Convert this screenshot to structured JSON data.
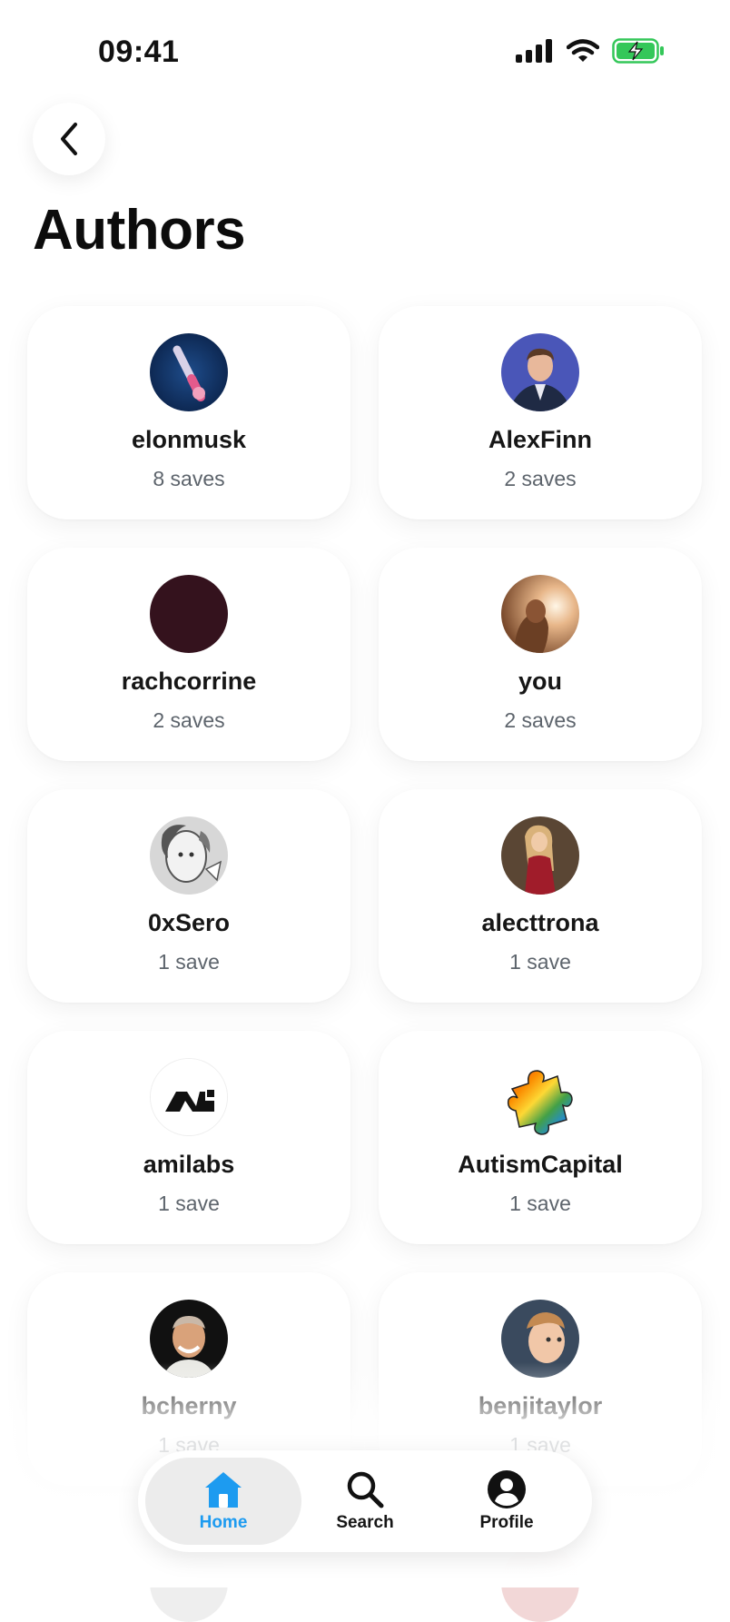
{
  "status_bar": {
    "time": "09:41"
  },
  "header": {
    "title": "Authors",
    "back_icon": "chevron-left-icon"
  },
  "authors": [
    {
      "name": "elonmusk",
      "saves": "8 saves"
    },
    {
      "name": "AlexFinn",
      "saves": "2 saves"
    },
    {
      "name": "rachcorrine",
      "saves": "2 saves"
    },
    {
      "name": "you",
      "saves": "2 saves"
    },
    {
      "name": "0xSero",
      "saves": "1 save"
    },
    {
      "name": "alecttrona",
      "saves": "1 save"
    },
    {
      "name": "amilabs",
      "saves": "1 save"
    },
    {
      "name": "AutismCapital",
      "saves": "1 save"
    },
    {
      "name": "bcherny",
      "saves": "1 save"
    },
    {
      "name": "benjitaylor",
      "saves": "1 save"
    }
  ],
  "tab_bar": {
    "tabs": [
      {
        "label": "Home",
        "icon": "home-icon",
        "active": true
      },
      {
        "label": "Search",
        "icon": "search-icon",
        "active": false
      },
      {
        "label": "Profile",
        "icon": "profile-icon",
        "active": false
      }
    ]
  },
  "colors": {
    "accent": "#1d9bf0",
    "muted_text": "#5d646c",
    "battery": "#34c759"
  }
}
